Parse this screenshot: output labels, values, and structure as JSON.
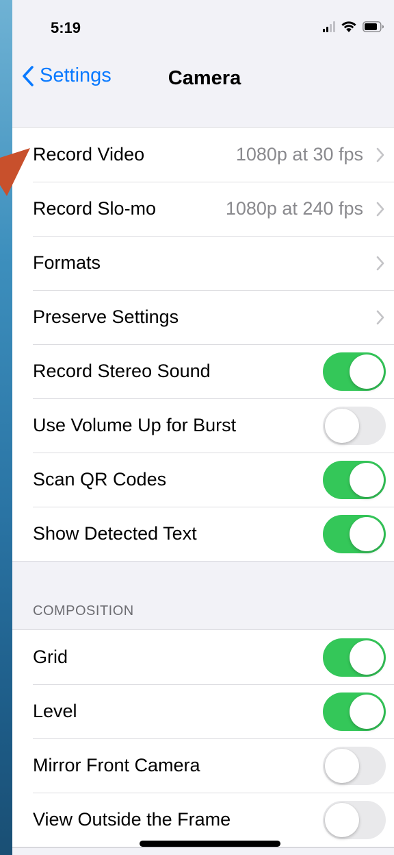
{
  "status_bar": {
    "time": "5:19",
    "icons": [
      "cellular-signal-icon",
      "wifi-icon",
      "battery-icon"
    ]
  },
  "nav": {
    "back_label": "Settings",
    "title": "Camera"
  },
  "colors": {
    "accent": "#0a7aff",
    "toggle_on": "#34c759",
    "toggle_off": "#e9e9eb",
    "arrow": "#c8502c"
  },
  "main_group": {
    "rows": [
      {
        "label": "Record Video",
        "value": "1080p at 30 fps",
        "type": "link"
      },
      {
        "label": "Record Slo-mo",
        "value": "1080p at 240 fps",
        "type": "link"
      },
      {
        "label": "Formats",
        "value": "",
        "type": "link"
      },
      {
        "label": "Preserve Settings",
        "value": "",
        "type": "link"
      },
      {
        "label": "Record Stereo Sound",
        "type": "toggle",
        "on": true
      },
      {
        "label": "Use Volume Up for Burst",
        "type": "toggle",
        "on": false
      },
      {
        "label": "Scan QR Codes",
        "type": "toggle",
        "on": true
      },
      {
        "label": "Show Detected Text",
        "type": "toggle",
        "on": true
      }
    ]
  },
  "composition": {
    "header": "COMPOSITION",
    "rows": [
      {
        "label": "Grid",
        "type": "toggle",
        "on": true
      },
      {
        "label": "Level",
        "type": "toggle",
        "on": true
      },
      {
        "label": "Mirror Front Camera",
        "type": "toggle",
        "on": false
      },
      {
        "label": "View Outside the Frame",
        "type": "toggle",
        "on": false
      }
    ]
  }
}
